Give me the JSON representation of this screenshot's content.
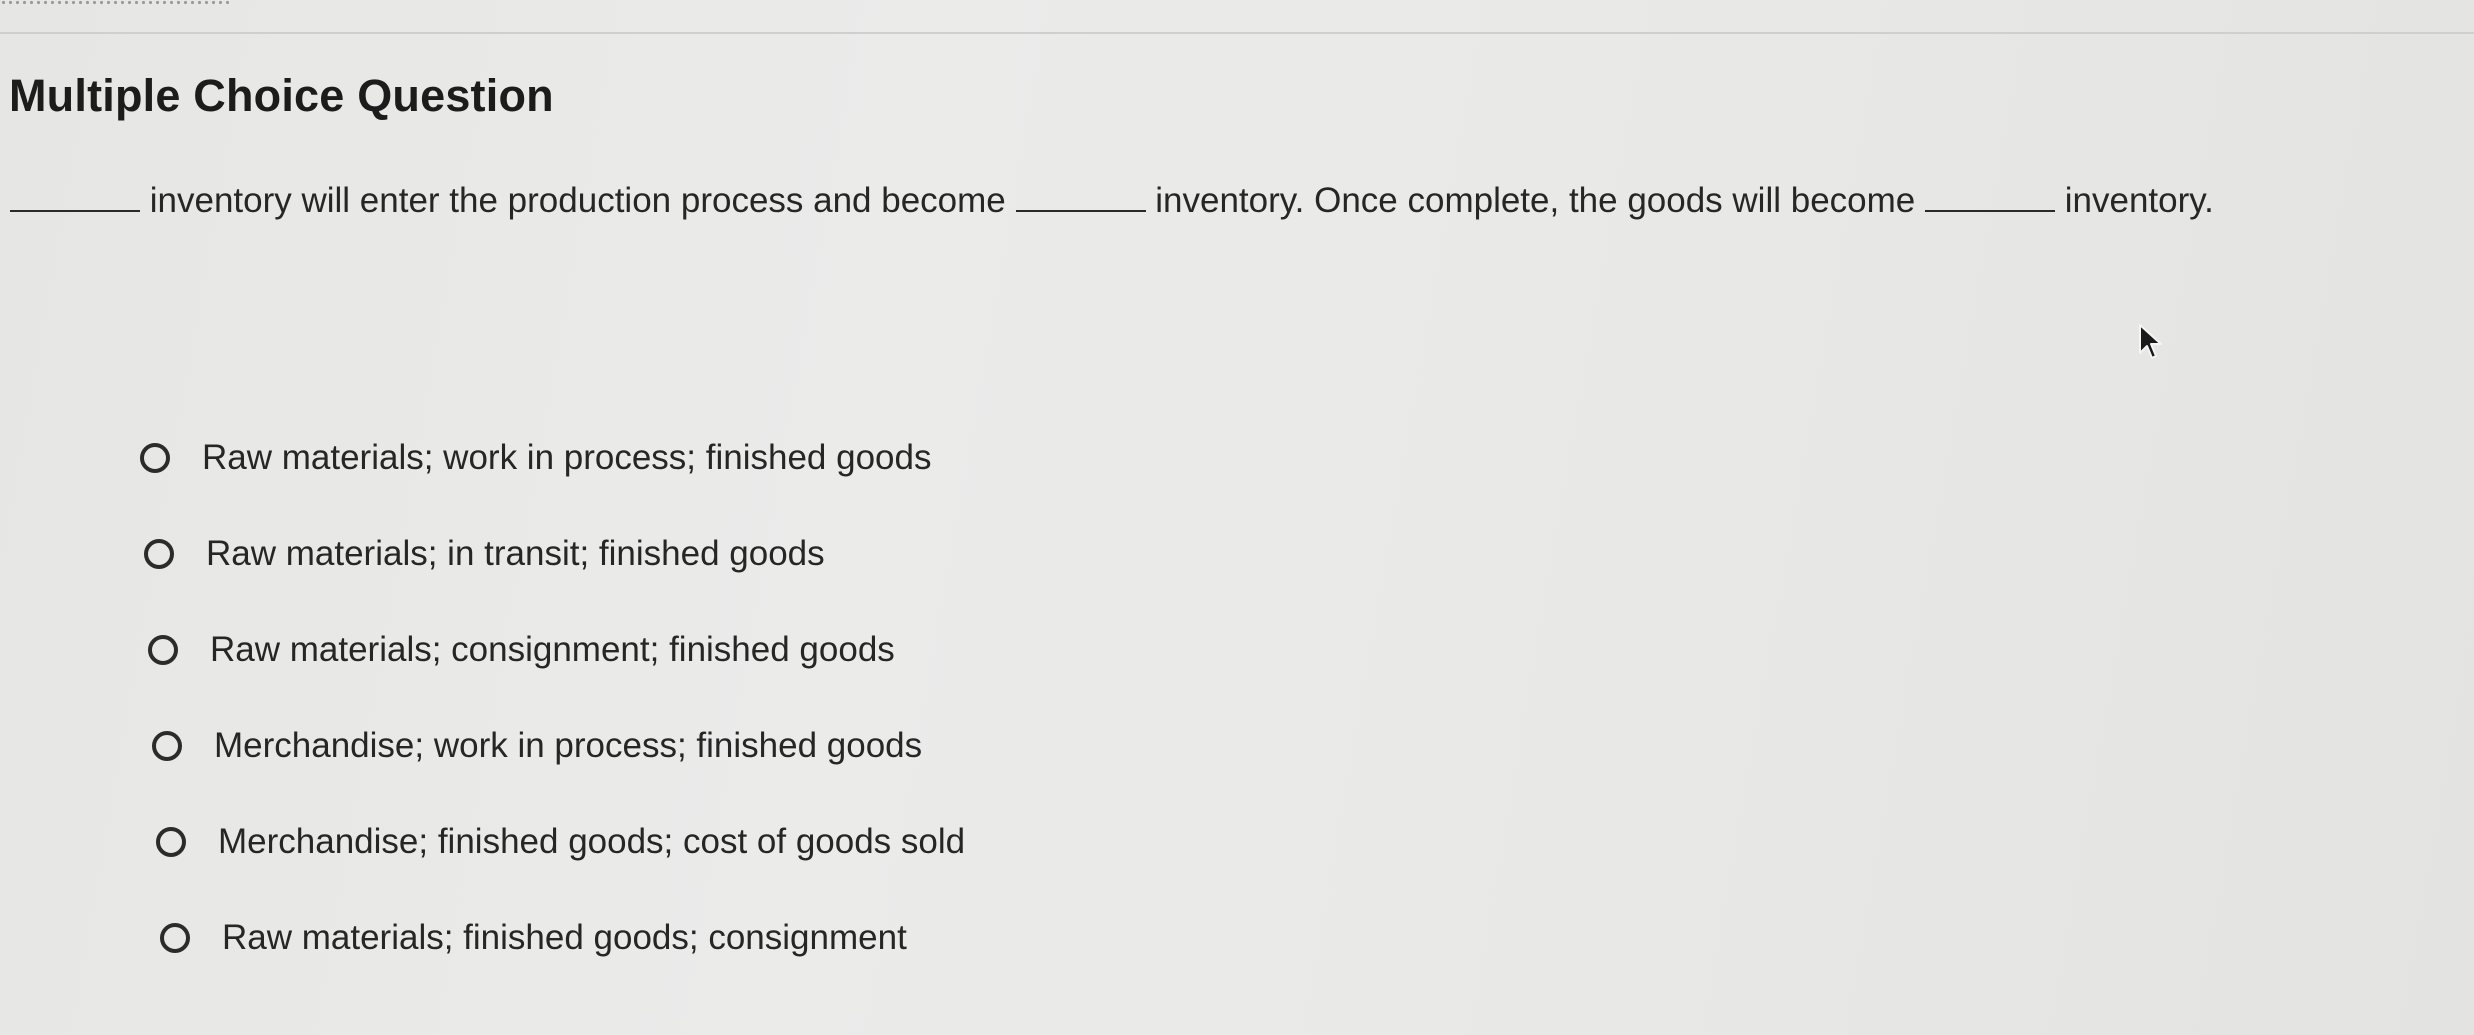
{
  "question": {
    "title": "Multiple Choice Question",
    "prompt_parts": [
      "inventory will enter the production process and become",
      "inventory. Once complete, the goods will become",
      "inventory."
    ]
  },
  "options": [
    "Raw materials; work in process; finished goods",
    "Raw materials; in transit; finished goods",
    "Raw materials; consignment; finished goods",
    "Merchandise; work in process; finished goods",
    "Merchandise; finished goods; cost of goods sold",
    "Raw materials; finished goods; consignment"
  ],
  "selected_option": null,
  "icons": {
    "radio": "radio-unselected-icon",
    "cursor": "mouse-pointer-icon"
  }
}
